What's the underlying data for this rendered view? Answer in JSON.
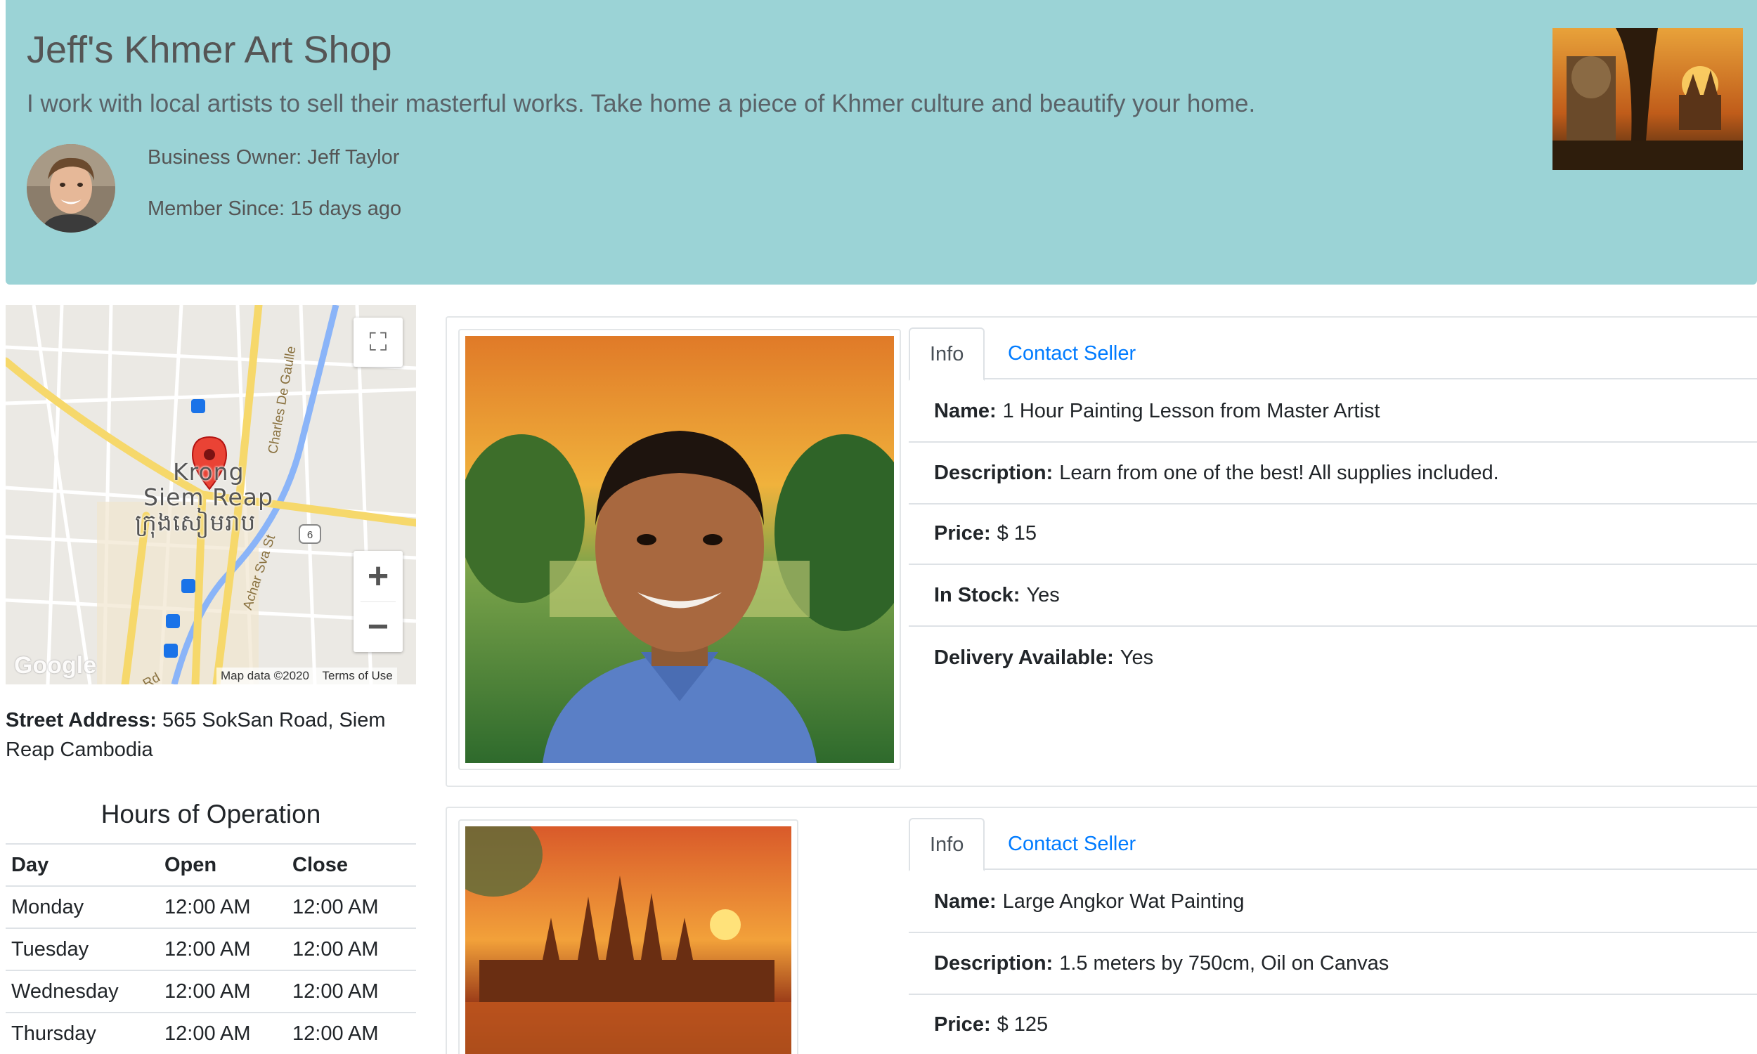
{
  "header": {
    "title": "Jeff's Khmer Art Shop",
    "tagline": "I work with local artists to sell their masterful works. Take home a piece of Khmer culture and beautify your home.",
    "owner_label": "Business Owner:",
    "owner_name": "Jeff Taylor",
    "member_label": "Member Since:",
    "member_since": "15 days ago",
    "background_color": "#9bd3d6"
  },
  "map": {
    "city_line1": "Krong",
    "city_line2": "Siem Reap",
    "city_line3": "ក្រុងសៀមរាប",
    "road_labels": [
      "Charles De Gaulle",
      "Achar Sva St",
      "Rd"
    ],
    "route_shield": "6",
    "logo": "Google",
    "map_data": "Map data ©2020",
    "terms": "Terms of Use",
    "fullscreen_icon": "fullscreen-icon",
    "zoom_in_label": "+",
    "zoom_out_label": "−"
  },
  "address": {
    "label": "Street Address:",
    "value": "565 SokSan Road, Siem Reap Cambodia"
  },
  "hours": {
    "title": "Hours of Operation",
    "columns": [
      "Day",
      "Open",
      "Close"
    ],
    "rows": [
      {
        "day": "Monday",
        "open": "12:00 AM",
        "close": "12:00 AM"
      },
      {
        "day": "Tuesday",
        "open": "12:00 AM",
        "close": "12:00 AM"
      },
      {
        "day": "Wednesday",
        "open": "12:00 AM",
        "close": "12:00 AM"
      },
      {
        "day": "Thursday",
        "open": "12:00 AM",
        "close": "12:00 AM"
      }
    ]
  },
  "products": [
    {
      "tab_info": "Info",
      "tab_contact": "Contact Seller",
      "name_label": "Name:",
      "name": "1 Hour Painting Lesson from Master Artist",
      "description_label": "Description:",
      "description": "Learn from one of the best! All supplies included.",
      "price_label": "Price:",
      "price": "$ 15",
      "stock_label": "In Stock:",
      "stock": "Yes",
      "delivery_label": "Delivery Available:",
      "delivery": "Yes"
    },
    {
      "tab_info": "Info",
      "tab_contact": "Contact Seller",
      "name_label": "Name:",
      "name": "Large Angkor Wat Painting",
      "description_label": "Description:",
      "description": "1.5 meters by 750cm, Oil on Canvas",
      "price_label": "Price:",
      "price": "$ 125"
    }
  ],
  "colors": {
    "link": "#007bff",
    "border": "#dee2e6"
  }
}
